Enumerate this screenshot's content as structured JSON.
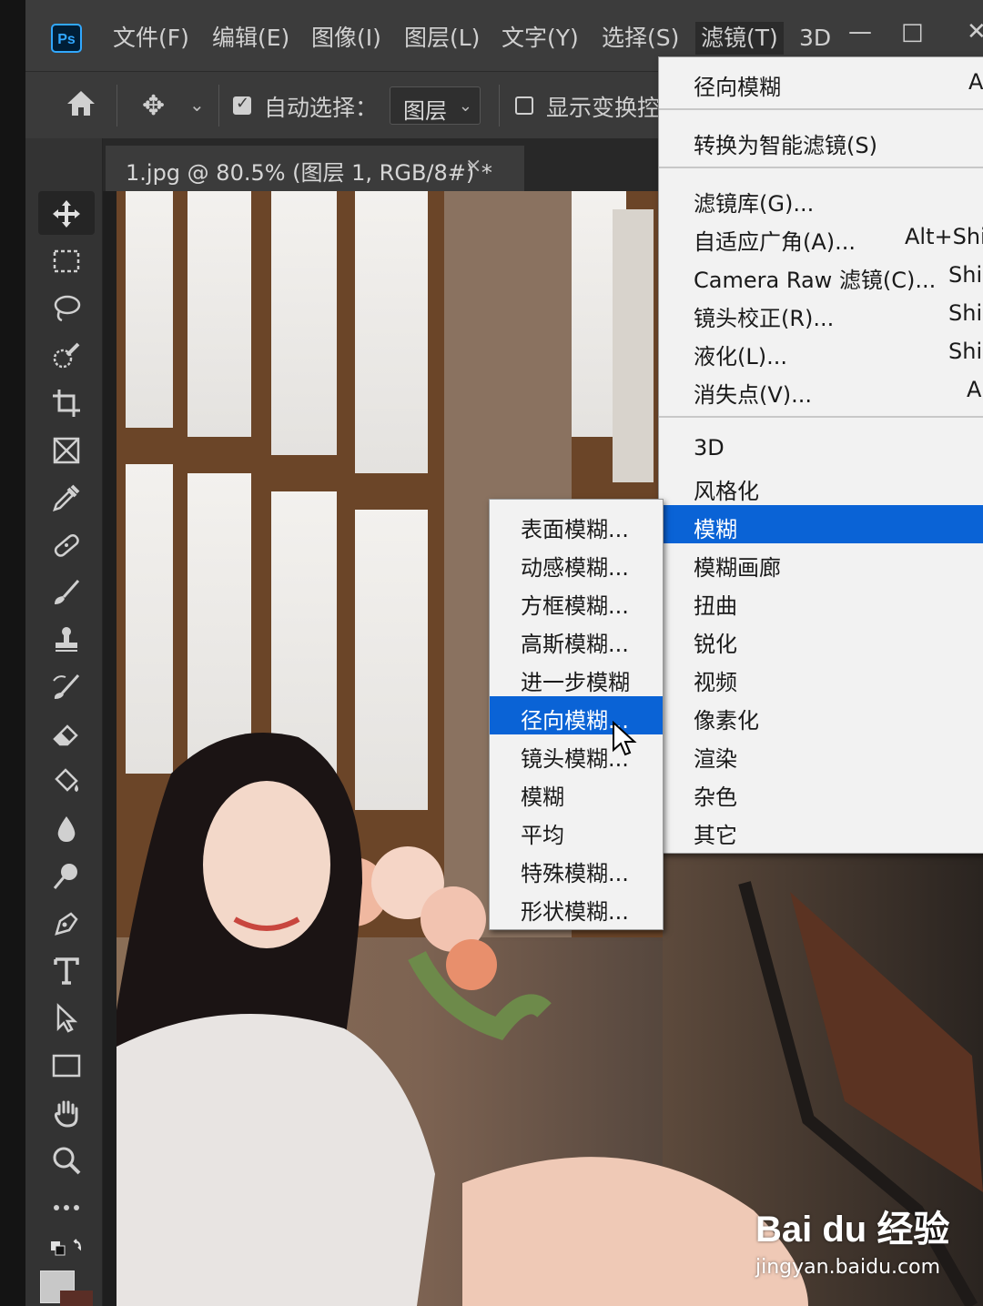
{
  "app": {
    "logo_text": "Ps"
  },
  "menubar": {
    "items": [
      "文件(F)",
      "编辑(E)",
      "图像(I)",
      "图层(L)",
      "文字(Y)",
      "选择(S)",
      "滤镜(T)",
      "3D"
    ],
    "window_controls": [
      "—",
      "□",
      "✕"
    ]
  },
  "options_bar": {
    "auto_select_label": "自动选择：",
    "auto_select_checked": true,
    "layer_dropdown_value": "图层",
    "show_transform_label": "显示变换控",
    "show_transform_checked": false
  },
  "document": {
    "tab_title": "1.jpg @ 80.5% (图层 1, RGB/8#) *",
    "tab_close": "×"
  },
  "tools": [
    "move-tool-icon",
    "marquee-tool-icon",
    "lasso-tool-icon",
    "quick-select-tool-icon",
    "crop-tool-icon",
    "frame-tool-icon",
    "eyedropper-tool-icon",
    "healing-brush-tool-icon",
    "brush-tool-icon",
    "clone-stamp-tool-icon",
    "history-brush-tool-icon",
    "eraser-tool-icon",
    "paint-bucket-tool-icon",
    "blur-tool-icon",
    "dodge-tool-icon",
    "pen-tool-icon",
    "type-tool-icon",
    "path-select-tool-icon",
    "rectangle-tool-icon",
    "hand-tool-icon",
    "zoom-tool-icon",
    "more-tools-icon",
    "swap-colors-icon",
    "color-swatch-icon"
  ],
  "filter_menu": {
    "last_filter": {
      "label": "径向模糊",
      "shortcut": "A"
    },
    "convert_smart": {
      "label": "转换为智能滤镜(S)"
    },
    "group2": [
      {
        "label": "滤镜库(G)...",
        "shortcut": ""
      },
      {
        "label": "自适应广角(A)...",
        "shortcut": "Alt+Shi"
      },
      {
        "label": "Camera Raw 滤镜(C)...",
        "shortcut": "Shi"
      },
      {
        "label": "镜头校正(R)...",
        "shortcut": "Shi"
      },
      {
        "label": "液化(L)...",
        "shortcut": "Shi"
      },
      {
        "label": "消失点(V)...",
        "shortcut": "A"
      }
    ],
    "categories": [
      "3D",
      "风格化",
      "模糊",
      "模糊画廊",
      "扭曲",
      "锐化",
      "视频",
      "像素化",
      "渲染",
      "杂色",
      "其它"
    ],
    "highlighted_category": "模糊"
  },
  "blur_submenu": {
    "items": [
      "表面模糊...",
      "动感模糊...",
      "方框模糊...",
      "高斯模糊...",
      "进一步模糊",
      "径向模糊...",
      "镜头模糊...",
      "模糊",
      "平均",
      "特殊模糊...",
      "形状模糊..."
    ],
    "highlighted": "径向模糊..."
  },
  "watermark": {
    "logo": "Bai du 经验",
    "url": "jingyan.baidu.com"
  },
  "colors": {
    "highlight": "#0a63d6",
    "menu_bg": "#f2f2f2",
    "chrome": "#3c3c3c"
  }
}
